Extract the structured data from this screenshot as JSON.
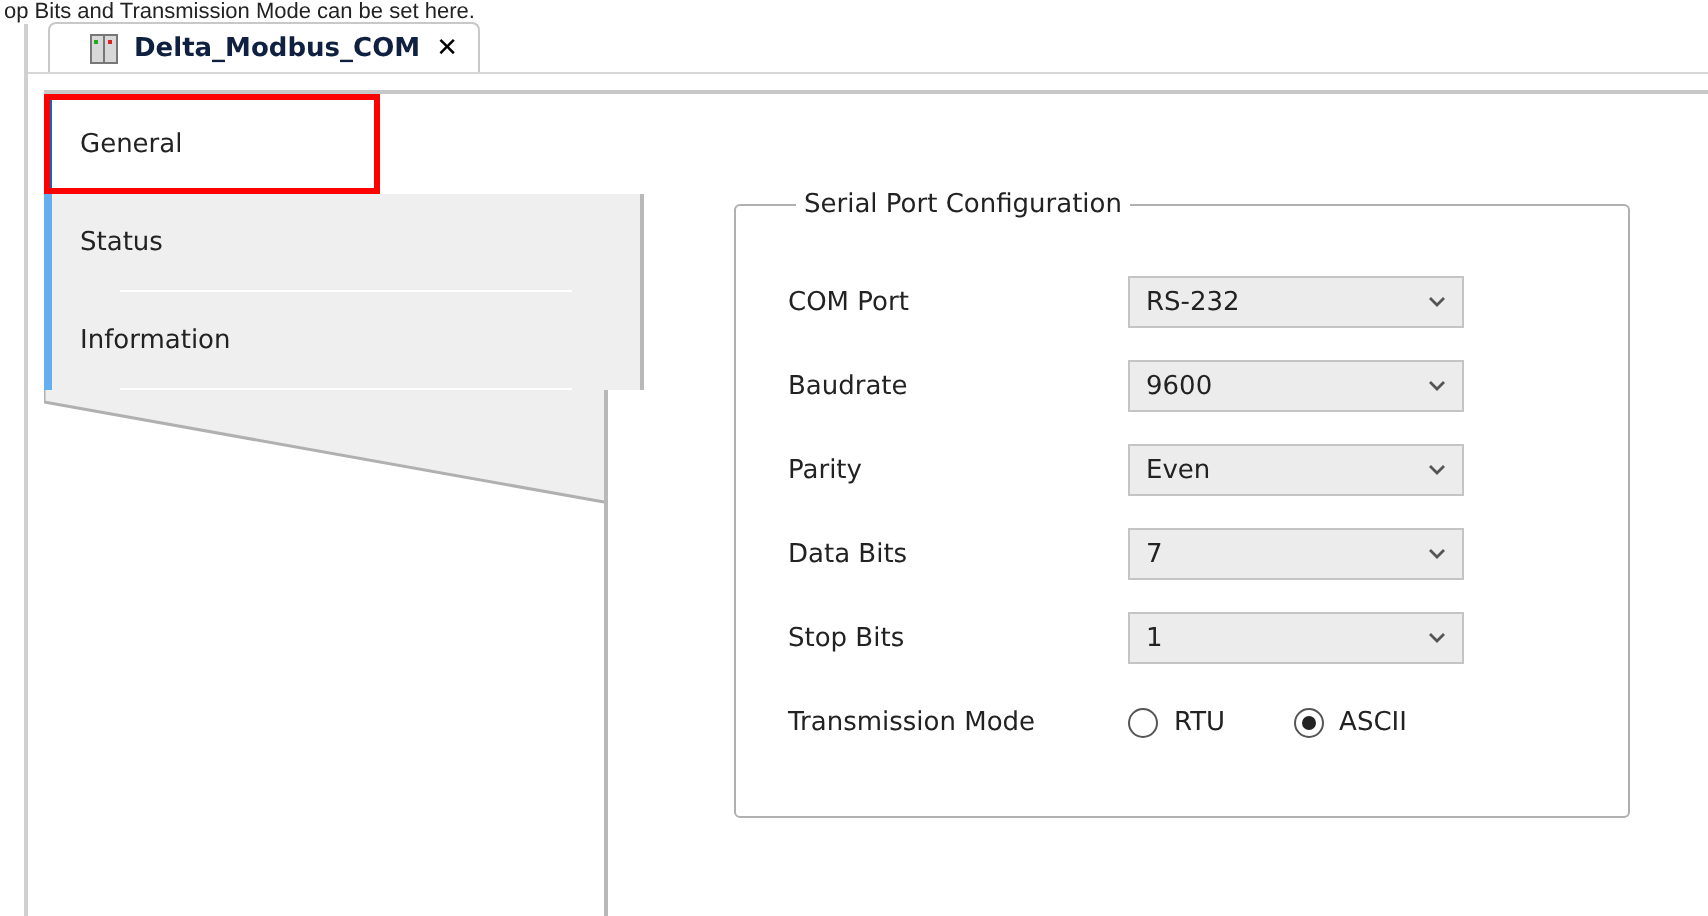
{
  "caption": "op Bits and Transmission Mode can be set here.",
  "tab": {
    "title": "Delta_Modbus_COM",
    "close": "✕"
  },
  "nav": [
    {
      "label": "General",
      "selected": true,
      "highlighted": true
    },
    {
      "label": "Status",
      "selected": false,
      "highlighted": false
    },
    {
      "label": "Information",
      "selected": false,
      "highlighted": false
    }
  ],
  "group": {
    "title": "Serial Port Configuration",
    "fields": [
      {
        "kind": "dropdown",
        "label": "COM Port",
        "value": "RS-232"
      },
      {
        "kind": "dropdown",
        "label": "Baudrate",
        "value": "9600"
      },
      {
        "kind": "dropdown",
        "label": "Parity",
        "value": "Even"
      },
      {
        "kind": "dropdown",
        "label": "Data Bits",
        "value": "7"
      },
      {
        "kind": "dropdown",
        "label": "Stop Bits",
        "value": "1"
      },
      {
        "kind": "radio",
        "label": "Transmission Mode",
        "options": [
          {
            "label": "RTU",
            "selected": false
          },
          {
            "label": "ASCII",
            "selected": true
          }
        ]
      }
    ]
  }
}
